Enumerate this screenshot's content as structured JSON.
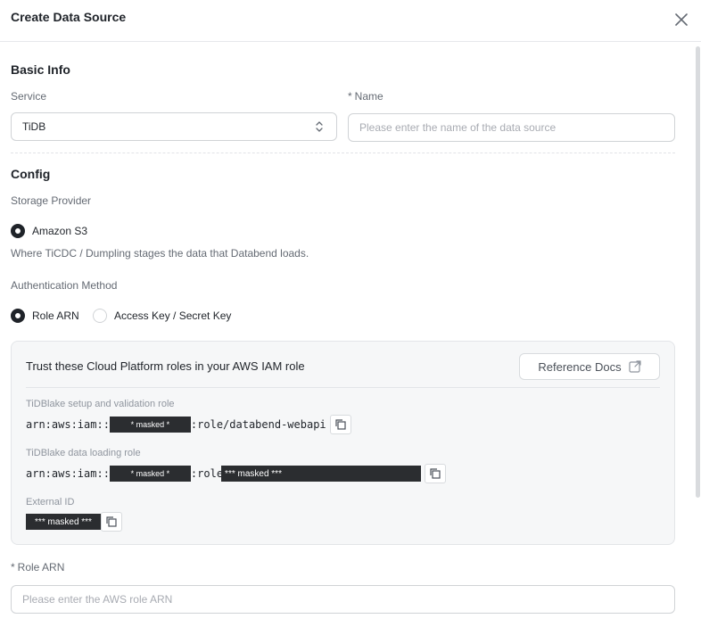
{
  "dialog": {
    "title": "Create Data Source"
  },
  "basic_info": {
    "title": "Basic Info",
    "service_label": "Service",
    "service_value": "TiDB",
    "name_label": "Name",
    "name_required_mark": "*",
    "name_placeholder": "Please enter the name of the data source"
  },
  "config": {
    "title": "Config",
    "storage_provider_label": "Storage Provider",
    "storage_option": "Amazon S3",
    "storage_help": "Where TiCDC / Dumpling stages the data that Databend loads.",
    "auth_method_label": "Authentication Method",
    "auth_options": [
      {
        "label": "Role ARN",
        "checked": true
      },
      {
        "label": "Access Key / Secret Key",
        "checked": false
      }
    ]
  },
  "trust_panel": {
    "title": "Trust these Cloud Platform roles in your AWS IAM role",
    "reference_docs_label": "Reference Docs",
    "setup_role_label": "TiDBlake setup and validation role",
    "setup_role_prefix": "arn:aws:iam::",
    "setup_role_mask": "* masked *",
    "setup_role_suffix": ":role/databend-webapi",
    "loading_role_label": "TiDBlake data loading role",
    "loading_role_prefix": "arn:aws:iam::",
    "loading_role_mask": "* masked *",
    "loading_role_mid": ":role",
    "loading_role_mask2": "*** masked ***",
    "external_id_label": "External ID",
    "external_id_mask": "*** masked ***"
  },
  "role_arn": {
    "label": "Role ARN",
    "required_mark": "*",
    "placeholder": "Please enter the AWS role ARN"
  }
}
